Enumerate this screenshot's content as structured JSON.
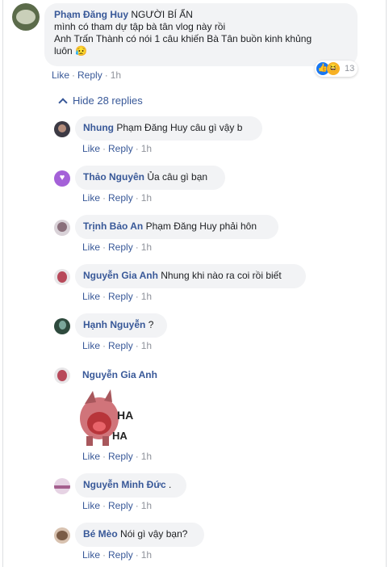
{
  "top_comment": {
    "author": "Phạm Đăng Huy",
    "lines": [
      "NGƯỜI BÍ ẨN",
      "mình có tham dự tập bà tân vlog này rồi",
      "Anh Trấn Thành có nói 1 câu khiến Bà Tân buồn kinh khủng",
      "luôn"
    ],
    "emoji": "😥",
    "reaction_count": "13",
    "like": "Like",
    "reply": "Reply",
    "time": "1h"
  },
  "hide_replies": "Hide 28 replies",
  "replies": [
    {
      "author": "Nhung",
      "text": "Phạm Đăng Huy câu gì vậy b",
      "like": "Like",
      "reply": "Reply",
      "time": "1h"
    },
    {
      "author": "Thảo Nguyên",
      "text": "Ủa câu gì bạn",
      "like": "Like",
      "reply": "Reply",
      "time": "1h"
    },
    {
      "author": "Trịnh Bảo An",
      "text": "Phạm Đăng Huy phải hôn",
      "like": "Like",
      "reply": "Reply",
      "time": "1h"
    },
    {
      "author": "Nguyễn Gia Anh",
      "text": "Nhung khi nào ra coi rồi biết",
      "like": "Like",
      "reply": "Reply",
      "time": "1h"
    },
    {
      "author": "Hạnh Nguyễn",
      "text": "?",
      "like": "Like",
      "reply": "Reply",
      "time": "1h"
    },
    {
      "author": "Nguyễn Gia Anh",
      "text": "",
      "sticker_text": [
        "HA",
        "HA"
      ],
      "like": "Like",
      "reply": "Reply",
      "time": "1h"
    },
    {
      "author": "Nguyễn Minh Đức",
      "text": ".",
      "like": "Like",
      "reply": "Reply",
      "time": "1h"
    },
    {
      "author": "Bé Mèo",
      "text": "Nói gì vậy bạn?",
      "like": "Like",
      "reply": "Reply",
      "time": "1h"
    }
  ],
  "colors": {
    "link": "#385898",
    "bubble": "#f2f3f5",
    "meta": "#90949c",
    "like_blue": "#1877f2",
    "haha_yellow": "#f7b125"
  }
}
